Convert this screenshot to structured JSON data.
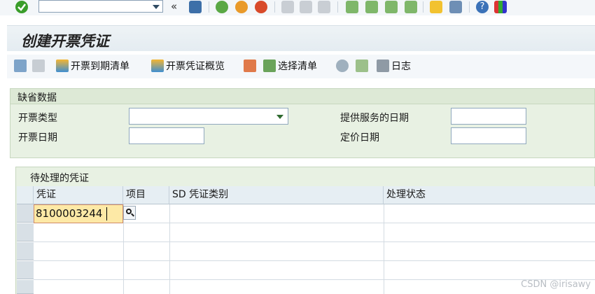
{
  "screen": {
    "title": "创建开票凭证"
  },
  "toolbar": {
    "command_field": "",
    "buttons": [
      {
        "label": "开票到期清单",
        "icon": "mountain-sun-icon"
      },
      {
        "label": "开票凭证概览",
        "icon": "mountain-sun-icon"
      },
      {
        "label": "选择清单",
        "icon": "select-list-icon"
      },
      {
        "label": "日志",
        "icon": "table-log-icon"
      }
    ]
  },
  "default_data": {
    "header": "缺省数据",
    "billing_type_label": "开票类型",
    "billing_type_value": "",
    "billing_date_label": "开票日期",
    "billing_date_value": "",
    "service_date_label": "提供服务的日期",
    "service_date_value": "",
    "pricing_date_label": "定价日期",
    "pricing_date_value": ""
  },
  "pending_docs": {
    "header": "待处理的凭证",
    "columns": [
      "凭证",
      "项目",
      "SD 凭证类别",
      "处理状态"
    ],
    "rows": [
      {
        "document": "8100003244",
        "item": "",
        "category": "",
        "status": ""
      }
    ]
  },
  "watermark": "CSDN @irisawy",
  "colors": {
    "group_bg": "#e8f1e3",
    "active_cell": "#fde9a6",
    "accent_green": "#3a9d2a"
  }
}
